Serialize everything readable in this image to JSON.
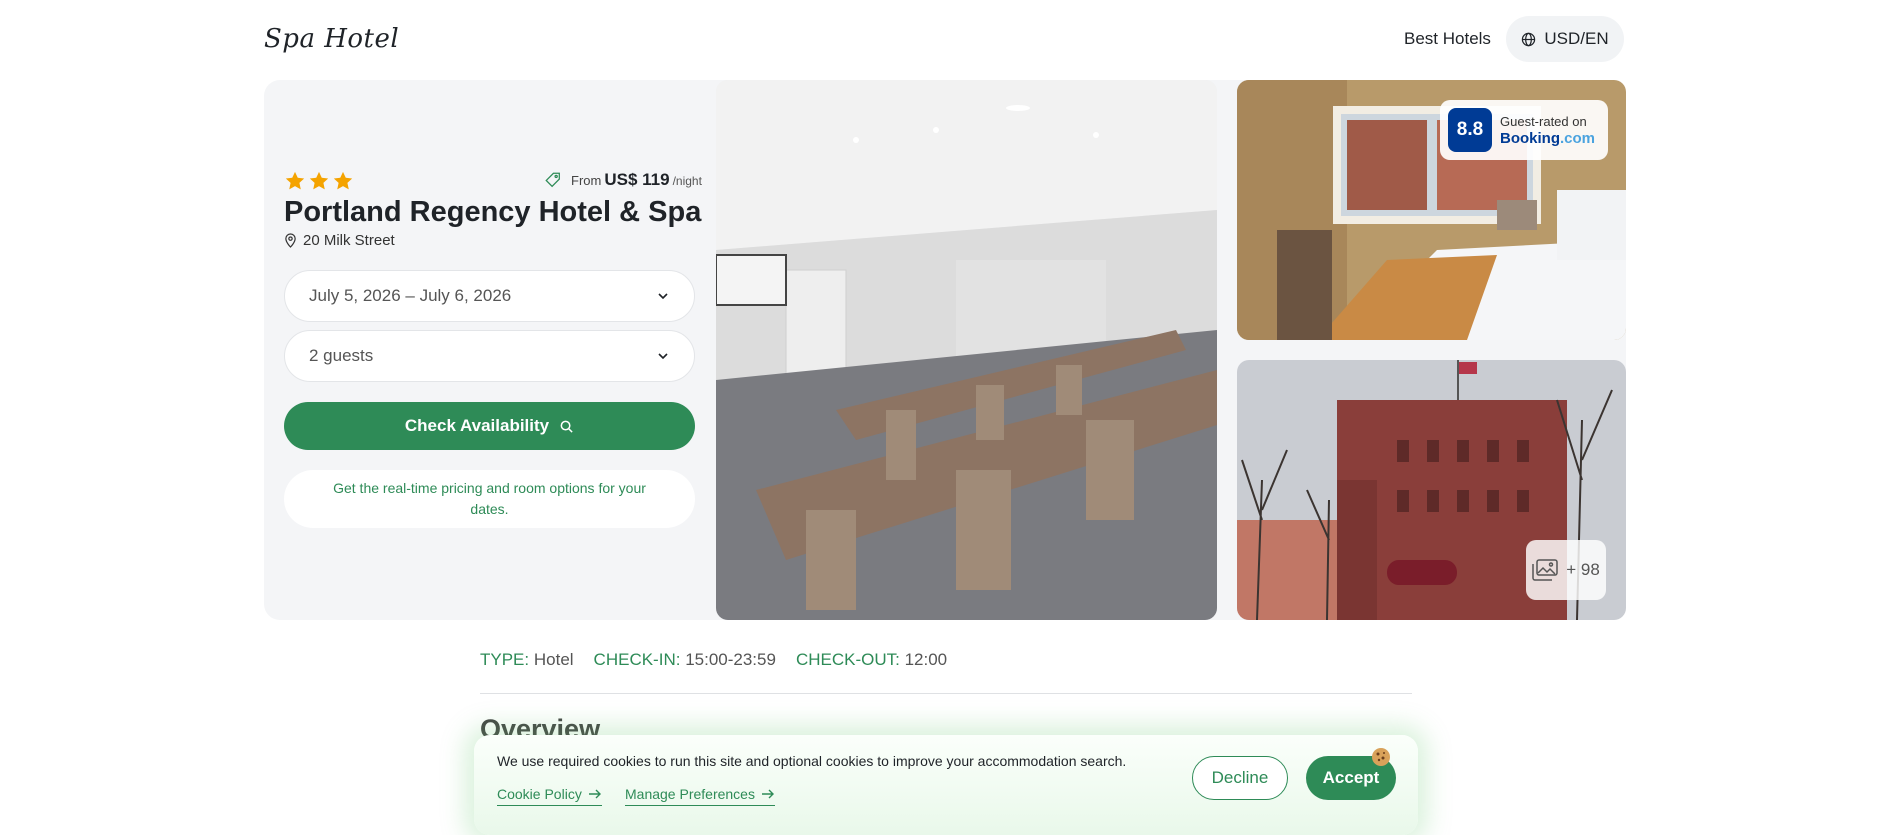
{
  "header": {
    "logo": "Spa Hotel",
    "nav_link": "Best Hotels",
    "currency": "USD/EN"
  },
  "hotel": {
    "stars": 3,
    "name": "Portland Regency Hotel & Spa",
    "address": "20 Milk Street",
    "price": {
      "from": "From",
      "amount": "US$ 119",
      "unit": "/night"
    }
  },
  "booking_form": {
    "dates": "July 5, 2026 – July 6, 2026",
    "guests": "2 guests",
    "check_button": "Check Availability",
    "info": "Get the real-time pricing and room options for your dates."
  },
  "rating": {
    "score": "8.8",
    "label": "Guest-rated on",
    "provider": "Booking",
    "provider_suffix": ".com"
  },
  "gallery": {
    "more": "+ 98"
  },
  "facts": [
    {
      "label": "TYPE:",
      "value": "Hotel"
    },
    {
      "label": "CHECK-IN:",
      "value": "15:00-23:59"
    },
    {
      "label": "CHECK-OUT:",
      "value": "12:00"
    }
  ],
  "overview": {
    "title": "Overview"
  },
  "cookie": {
    "text": "We use required cookies to run this site and optional cookies to improve your accommodation search.",
    "policy_link": "Cookie Policy",
    "preferences_link": "Manage Preferences",
    "decline": "Decline",
    "accept": "Accept"
  },
  "colors": {
    "primary_green": "#2e8b57",
    "star": "#f4a300",
    "booking_blue": "#003b95"
  }
}
